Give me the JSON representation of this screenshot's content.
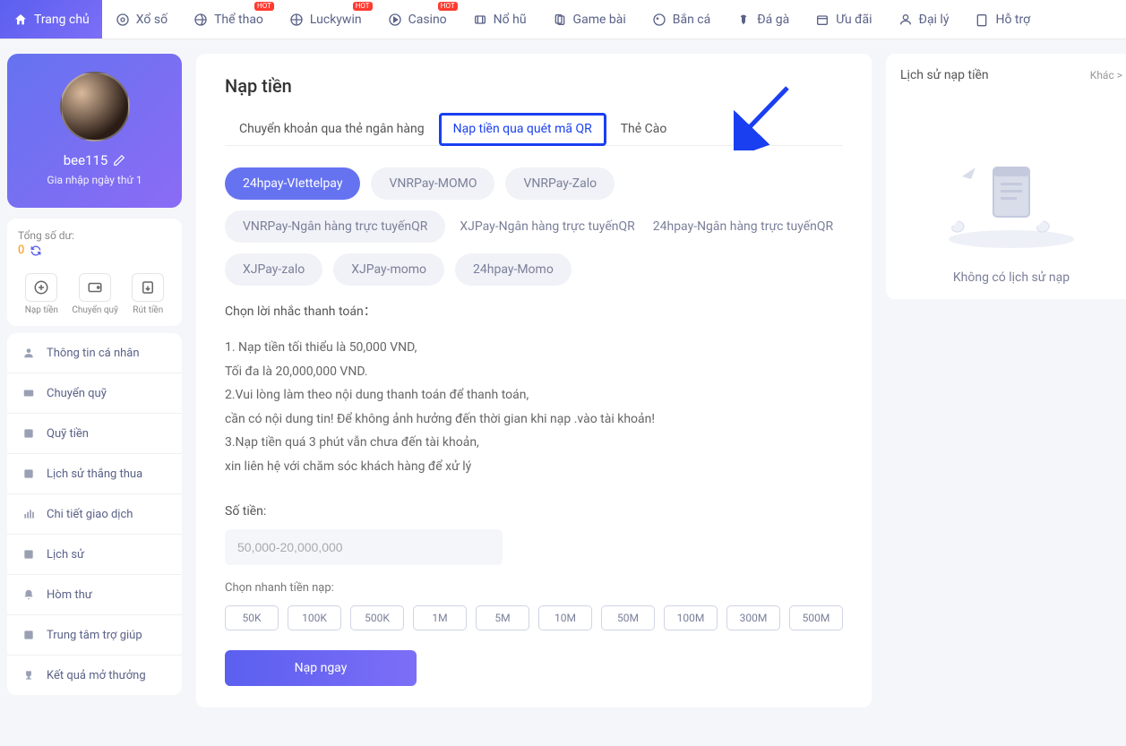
{
  "nav": {
    "items": [
      {
        "label": "Trang chủ"
      },
      {
        "label": "Xổ số"
      },
      {
        "label": "Thể thao",
        "hot": "HOT"
      },
      {
        "label": "Luckywin",
        "hot": "HOT"
      },
      {
        "label": "Casino",
        "hot": "HOT"
      },
      {
        "label": "Nổ hũ"
      },
      {
        "label": "Game bài"
      },
      {
        "label": "Bắn cá"
      },
      {
        "label": "Đá gà"
      },
      {
        "label": "Ưu đãi"
      },
      {
        "label": "Đại lý"
      },
      {
        "label": "Hỗ trợ"
      }
    ]
  },
  "profile": {
    "username": "bee115",
    "join_info": "Gia nhập ngày thứ 1"
  },
  "balance": {
    "label": "Tổng số dư:",
    "amount": "0"
  },
  "actions": {
    "deposit": "Nạp tiền",
    "transfer": "Chuyển quỹ",
    "withdraw": "Rút tiền"
  },
  "menu": [
    "Thông tin cá nhân",
    "Chuyển quỹ",
    "Quỹ tiền",
    "Lịch sử thắng thua",
    "Chi tiết giao dịch",
    "Lịch sử",
    "Hòm thư",
    "Trung tâm trợ giúp",
    "Kết quả mở thưởng"
  ],
  "main": {
    "title": "Nạp tiền",
    "tabs": [
      "Chuyển khoản qua thẻ ngân hàng",
      "Nạp tiền qua quét mã QR",
      "Thẻ Cào"
    ],
    "providers": [
      "24hpay-VIettelpay",
      "VNRPay-MOMO",
      "VNRPay-Zalo",
      "VNRPay-Ngân hàng trực tuyếnQR",
      "XJPay-Ngân hàng trực tuyếnQR",
      "24hpay-Ngân hàng trực tuyếnQR",
      "XJPay-zalo",
      "XJPay-momo",
      "24hpay-Momo"
    ],
    "reminder_title": "Chọn lời nhắc thanh toán：",
    "instructions": [
      "1. Nạp tiền tối thiểu là 50,000 VND,",
      "Tối đa là 20,000,000 VND.",
      "2.Vui lòng làm theo nội dung thanh toán để thanh toán,",
      "cần có nội dung tin! Để không ảnh hưởng đến thời gian khi nạp .vào tài khoản!",
      "3.Nạp tiền quá 3 phút vẫn chưa đến tài khoản,",
      "xin liên hệ với chăm sóc khách hàng để xử lý"
    ],
    "amount_label": "Số tiền:",
    "amount_placeholder": "50,000-20,000,000",
    "quick_label": "Chọn nhanh tiền nạp:",
    "quick_amounts": [
      "50K",
      "100K",
      "500K",
      "1M",
      "5M",
      "10M",
      "50M",
      "100M",
      "300M",
      "500M"
    ],
    "submit_label": "Nạp ngay"
  },
  "right": {
    "title": "Lịch sử nạp tiền",
    "more": "Khác >",
    "empty": "Không có lịch sử nạp"
  }
}
